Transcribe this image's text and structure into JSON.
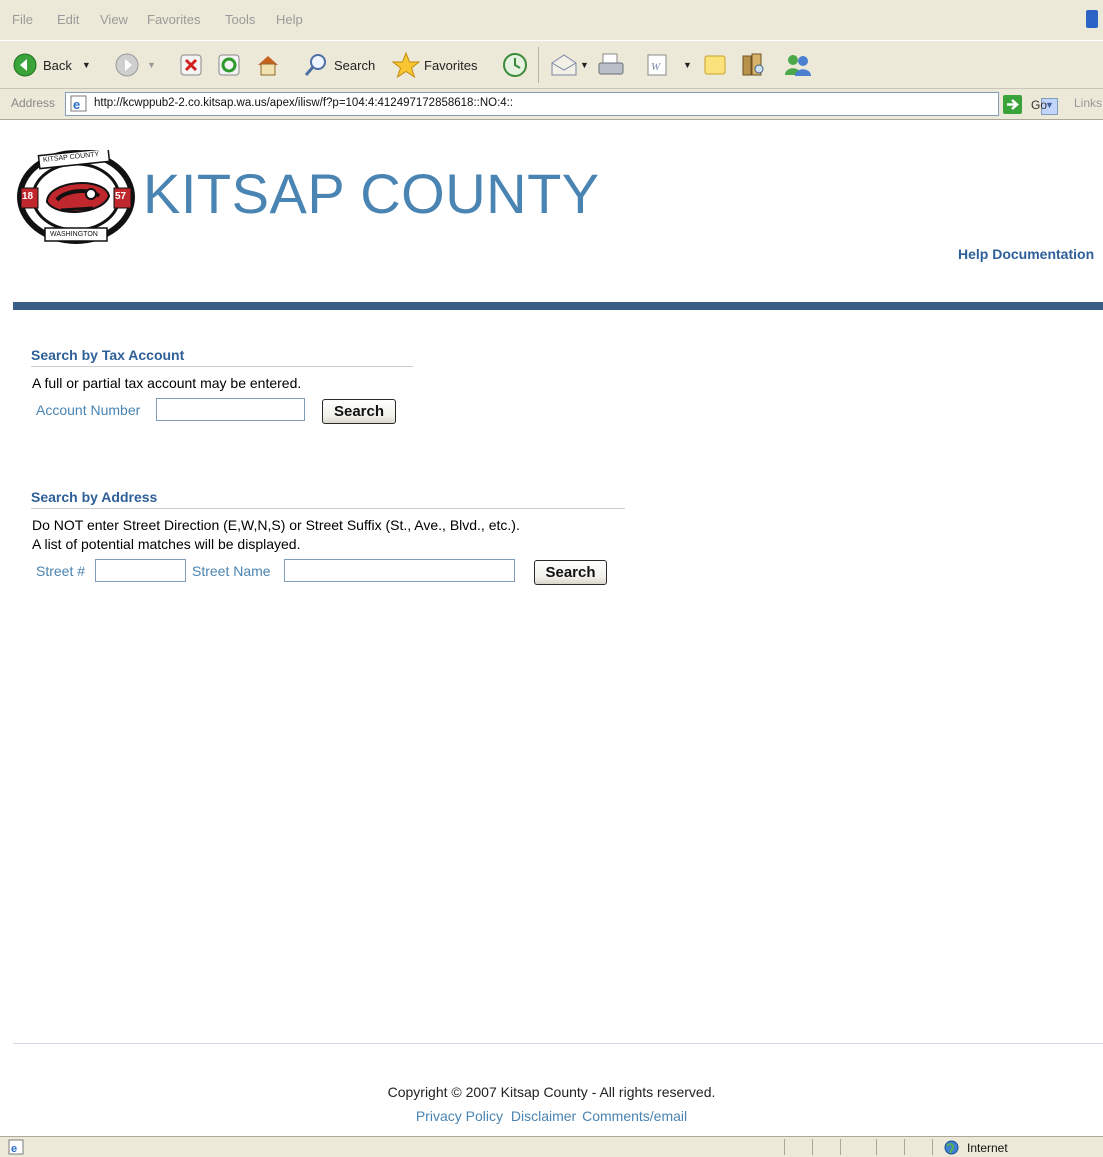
{
  "browser": {
    "menu": [
      "File",
      "Edit",
      "View",
      "Favorites",
      "Tools",
      "Help"
    ],
    "toolbar": {
      "back_label": "Back",
      "search_label": "Search",
      "favorites_label": "Favorites"
    },
    "address": {
      "label": "Address",
      "url": "http://kcwppub2-2.co.kitsap.wa.us/apex/ilisw/f?p=104:4:412497172858618::NO:4::",
      "go_label": "Go",
      "links_label": "Links"
    },
    "status": {
      "zone": "Internet"
    }
  },
  "header": {
    "title": "KITSAP COUNTY",
    "logo_top": "KITSAP COUNTY",
    "logo_bottom": "WASHINGTON",
    "logo_year_left": "18",
    "logo_year_right": "57",
    "help_link": "Help Documentation",
    "brand_color": "#4a84b2"
  },
  "tax_search": {
    "title": "Search by Tax Account",
    "instruction": "A full or partial tax account may be entered.",
    "account_label": "Account Number",
    "account_value": "",
    "button": "Search"
  },
  "address_search": {
    "title": "Search by Address",
    "instruction_1": "Do NOT enter Street Direction (E,W,N,S) or Street Suffix (St., Ave., Blvd., etc.).",
    "instruction_2": "A list of potential matches will be displayed.",
    "street_number_label": "Street #",
    "street_number_value": "",
    "street_name_label": "Street Name",
    "street_name_value": "",
    "button": "Search"
  },
  "footer": {
    "copyright": "Copyright © 2007 Kitsap County  -  All rights reserved.",
    "privacy_link": "Privacy Policy",
    "disclaimer_link": "Disclaimer",
    "comments_link": "Comments/email"
  }
}
